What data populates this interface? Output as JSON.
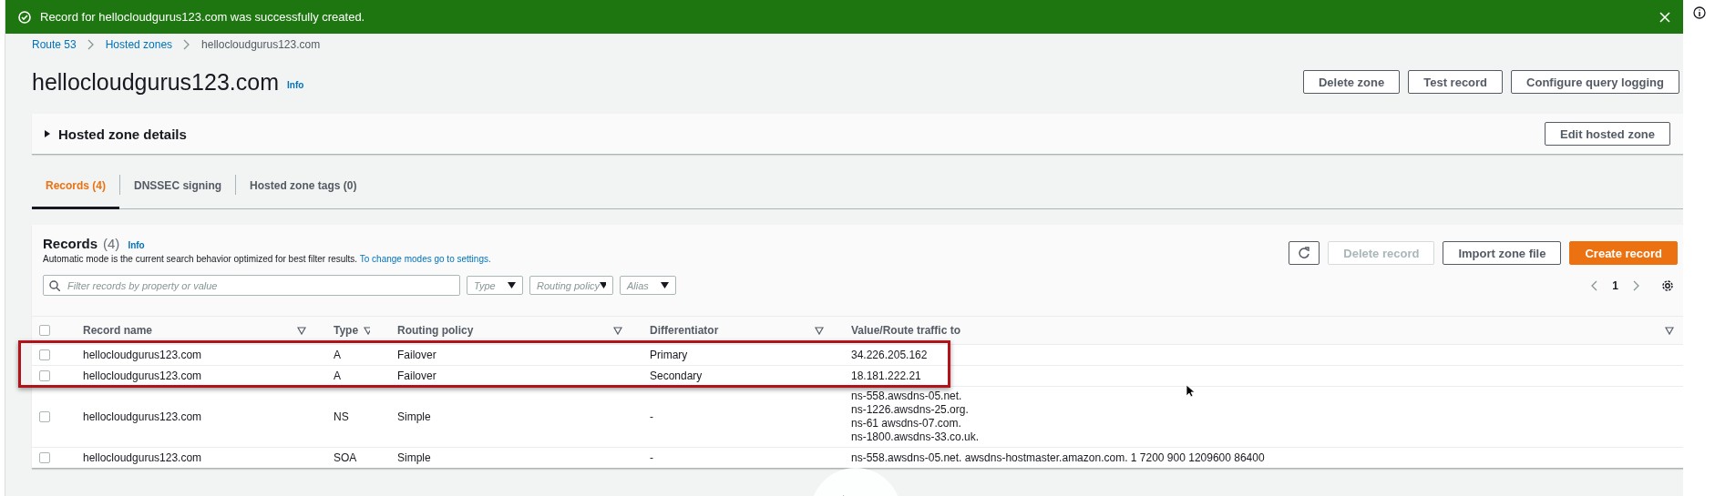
{
  "notification": {
    "message": "Record for hellocloudgurus123.com was successfully created."
  },
  "breadcrumbs": [
    {
      "label": "Route 53",
      "current": false
    },
    {
      "label": "Hosted zones",
      "current": false
    },
    {
      "label": "hellocloudgurus123.com",
      "current": true
    }
  ],
  "header": {
    "title": "hellocloudgurus123.com",
    "info": "Info",
    "buttons": [
      "Delete zone",
      "Test record",
      "Configure query logging"
    ]
  },
  "details": {
    "title": "Hosted zone details",
    "expanded": false,
    "button": "Edit hosted zone"
  },
  "tabs": [
    {
      "label": "Records (4)",
      "selected": true
    },
    {
      "label": "DNSSEC signing",
      "selected": false
    },
    {
      "label": "Hosted zone tags (0)",
      "selected": false
    }
  ],
  "records": {
    "title": "Records",
    "count": "(4)",
    "info": "Info",
    "description": "Automatic mode is the current search behavior optimized for best filter results.",
    "description_link": "To change modes go to settings.",
    "buttons": [
      {
        "kind": "refresh",
        "disabled": false
      },
      {
        "kind": "normal",
        "label": "Delete record",
        "disabled": true
      },
      {
        "kind": "normal",
        "label": "Import zone file",
        "disabled": false
      },
      {
        "kind": "primary",
        "label": "Create record",
        "disabled": false
      }
    ],
    "filter": {
      "placeholder": "Filter records by property or value"
    },
    "dropdowns": [
      {
        "placeholder": "Type"
      },
      {
        "placeholder": "Routing policy"
      },
      {
        "placeholder": "Alias"
      }
    ],
    "page": "1"
  },
  "table": {
    "select_all": {
      "checked": false
    },
    "columns": [
      "Record name",
      "Type",
      "Routing policy",
      "Differentiator",
      "Value/Route traffic to"
    ],
    "rows": [
      {
        "checked": false,
        "highlighted": true,
        "cells": [
          "hellocloudgurus123.com",
          "A",
          "Failover",
          "Primary"
        ],
        "values": [
          "34.226.205.162"
        ]
      },
      {
        "checked": false,
        "highlighted": true,
        "cells": [
          "hellocloudgurus123.com",
          "A",
          "Failover",
          "Secondary"
        ],
        "values": [
          "18.181.222.21"
        ]
      },
      {
        "checked": false,
        "highlighted": false,
        "cells": [
          "hellocloudgurus123.com",
          "NS",
          "Simple",
          "-"
        ],
        "values": [
          "ns-558.awsdns-05.net.",
          "ns-1226.awsdns-25.org.",
          "ns-61 awsdns-07.com.",
          "ns-1800.awsdns-33.co.uk."
        ]
      },
      {
        "checked": false,
        "highlighted": false,
        "cells": [
          "hellocloudgurus123.com",
          "SOA",
          "Simple",
          "-"
        ],
        "values": [
          "ns-558.awsdns-05.net. awsdns-hostmaster.amazon.com. 1 7200 900 1209600 86400"
        ]
      }
    ]
  }
}
